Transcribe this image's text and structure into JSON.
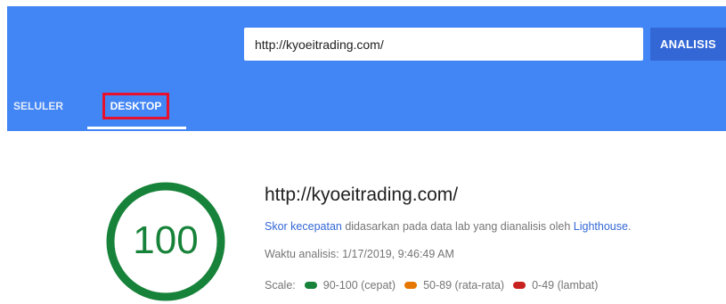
{
  "search": {
    "url_value": "http://kyoeitrading.com/",
    "analyze_label": "ANALISIS"
  },
  "tabs": {
    "mobile_label": "SELULER",
    "desktop_label": "DESKTOP",
    "active": "desktop"
  },
  "score": {
    "value": "100",
    "color": "#178239"
  },
  "result": {
    "url": "http://kyoeitrading.com/",
    "desc_link": "Skor kecepatan",
    "desc_text": " didasarkan pada data lab yang dianalisis oleh ",
    "desc_link2": "Lighthouse",
    "desc_end": ".",
    "timestamp_label": "Waktu analisis: 1/17/2019, 9:46:49 AM",
    "scale_label": "Scale:",
    "scale": [
      {
        "label": "90-100 (cepat)",
        "color": "#178239"
      },
      {
        "label": "50-89 (rata-rata)",
        "color": "#e67700"
      },
      {
        "label": "0-49 (lambat)",
        "color": "#c7221f"
      }
    ]
  },
  "colors": {
    "header_bg": "#4285f4",
    "button_bg": "#3367d6",
    "highlight_border": "#e8112d"
  }
}
